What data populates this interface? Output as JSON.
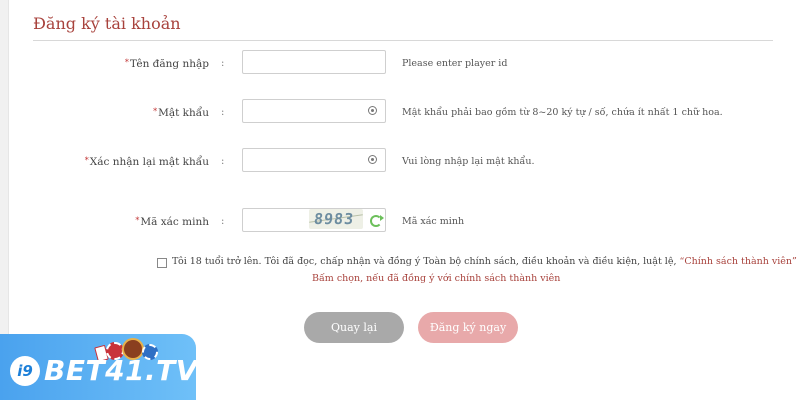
{
  "form": {
    "title": "Đăng ký tài khoản",
    "required_mark": "*",
    "colon": ":",
    "username": {
      "label": "Tên đăng nhập",
      "value": "",
      "hint": "Please enter player id"
    },
    "password": {
      "label": "Mật khẩu",
      "value": "",
      "hint": "Mật khẩu phải bao gồm từ 8~20 ký tự / số, chứa ít nhất 1 chữ hoa."
    },
    "confirm_password": {
      "label": "Xác nhận lại mật khẩu",
      "value": "",
      "hint": "Vui lòng nhập lại mật khẩu."
    },
    "captcha": {
      "label": "Mã xác minh",
      "value": "",
      "image_text": "8983",
      "hint": "Mã xác minh"
    },
    "agreement": {
      "text": "Tôi 18 tuổi trở lên. Tôi đã đọc, chấp nhận và đồng ý Toàn bộ chính sách, điều khoản và điều kiện, luật lệ,",
      "policy_link": "“Chính sách thành viên”",
      "note": "Bấm chọn, nếu đã đồng ý với chính sách thành viên",
      "checked": false
    },
    "buttons": {
      "back": "Quay lại",
      "register": "Đăng ký ngay"
    }
  },
  "brand": {
    "logo_mark": "i9",
    "logo_text": "BET41.TV",
    "color": "#4aa2ee"
  },
  "colors": {
    "accent": "#a8423c",
    "back_button": "#a9a9a9",
    "register_button": "#e8a9aa"
  },
  "icons": {
    "password_toggle": "eye-icon",
    "captcha_refresh": "refresh-icon"
  }
}
